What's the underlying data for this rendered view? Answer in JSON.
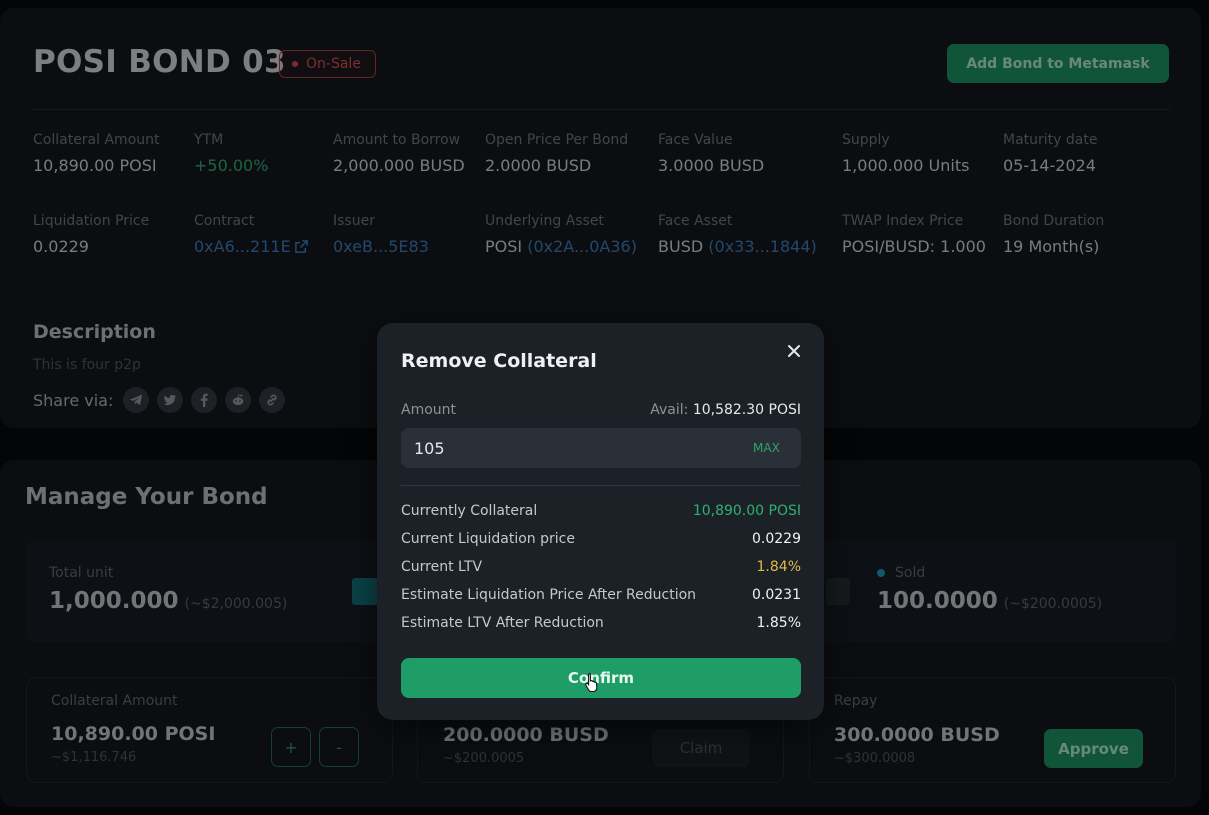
{
  "header": {
    "title": "POSI BOND 03",
    "status_badge": "On-Sale",
    "add_button": "Add Bond to Metamask"
  },
  "details": {
    "row1": [
      {
        "label": "Collateral Amount",
        "value": "10,890.00 POSI"
      },
      {
        "label": "YTM",
        "value": "+50.00%"
      },
      {
        "label": "Amount to Borrow",
        "value": "2,000.000 BUSD"
      },
      {
        "label": "Open Price Per Bond",
        "value": "2.0000 BUSD"
      },
      {
        "label": "Face Value",
        "value": "3.0000 BUSD"
      },
      {
        "label": "Supply",
        "value": "1,000.000 Units"
      },
      {
        "label": "Maturity date",
        "value": "05-14-2024"
      }
    ],
    "row2": [
      {
        "label": "Liquidation Price",
        "value": "0.0229"
      },
      {
        "label": "Contract",
        "value": "0xA6...211E"
      },
      {
        "label": "Issuer",
        "value": "0xeB...5E83"
      },
      {
        "label": "Underlying Asset",
        "value": "POSI",
        "link": "(0x2A...0A36)"
      },
      {
        "label": "Face Asset",
        "value": "BUSD",
        "link": "(0x33...1844)"
      },
      {
        "label": "TWAP Index Price",
        "value": "POSI/BUSD: 1.000"
      },
      {
        "label": "Bond Duration",
        "value": "19 Month(s)"
      }
    ]
  },
  "description": {
    "title": "Description",
    "text": "This is four p2p",
    "share_label": "Share via:",
    "share_icons": [
      "telegram-icon",
      "twitter-icon",
      "facebook-icon",
      "reddit-icon",
      "link-icon"
    ]
  },
  "manage": {
    "title": "Manage Your Bond",
    "total_label": "Total unit",
    "total_value": "1,000.000",
    "total_sub": "(~$2,000.005)",
    "sold_label": "Sold",
    "sold_value": "100.0000",
    "sold_sub": "(~$200.0005)",
    "collateral_label": "Collateral Amount",
    "collateral_value": "10,890.00 POSI",
    "collateral_sub": "~$1,116.746",
    "plus": "+",
    "minus": "-",
    "claim_value": "200.0000 BUSD",
    "claim_sub": "~$200.0005",
    "claim_button": "Claim",
    "repay_label": "Repay",
    "repay_value": "300.0000 BUSD",
    "repay_sub": "~$300.0008",
    "approve_button": "Approve"
  },
  "modal": {
    "title": "Remove Collateral",
    "amount_label": "Amount",
    "avail_prefix": "Avail:",
    "avail_value": "10,582.30 POSI",
    "amount_value": "105",
    "max_label": "MAX",
    "rows": [
      {
        "label": "Currently Collateral",
        "value": "10,890.00 POSI"
      },
      {
        "label": "Current Liquidation price",
        "value": "0.0229"
      },
      {
        "label": "Current LTV",
        "value": "1.84%"
      },
      {
        "label": "Estimate Liquidation Price After Reduction",
        "value": "0.0231"
      },
      {
        "label": "Estimate LTV After Reduction",
        "value": "1.85%"
      }
    ],
    "confirm_button": "Confirm"
  },
  "colors": {
    "accent_green": "#1f9d66",
    "badge_red": "#c94c4c",
    "link_blue": "#3a74b0",
    "ltv_yellow": "#e2b94a"
  }
}
